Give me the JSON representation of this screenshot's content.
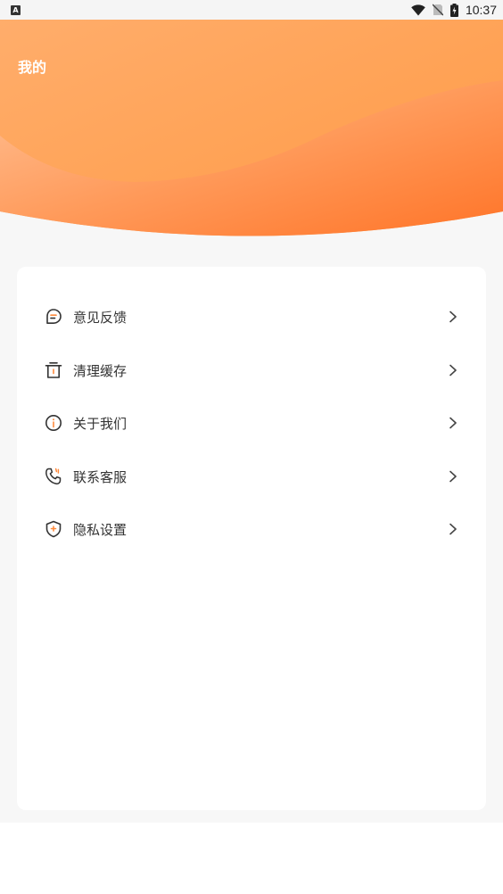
{
  "status_bar": {
    "notification_icon": "A",
    "time": "10:37",
    "icons": [
      "wifi-icon",
      "no-sim-icon",
      "battery-charging-icon"
    ]
  },
  "page": {
    "title": "我的"
  },
  "colors": {
    "accent": "#ff8a3d",
    "header_light": "#ffb067",
    "header_dark": "#ff7a2a",
    "card_bg": "#ffffff",
    "page_bg": "#f7f7f7",
    "text": "#333333"
  },
  "menu": {
    "items": [
      {
        "label": "意见反馈",
        "icon": "feedback-icon"
      },
      {
        "label": "清理缓存",
        "icon": "trash-icon"
      },
      {
        "label": "关于我们",
        "icon": "info-icon"
      },
      {
        "label": "联系客服",
        "icon": "phone-icon"
      },
      {
        "label": "隐私设置",
        "icon": "shield-icon"
      }
    ]
  }
}
